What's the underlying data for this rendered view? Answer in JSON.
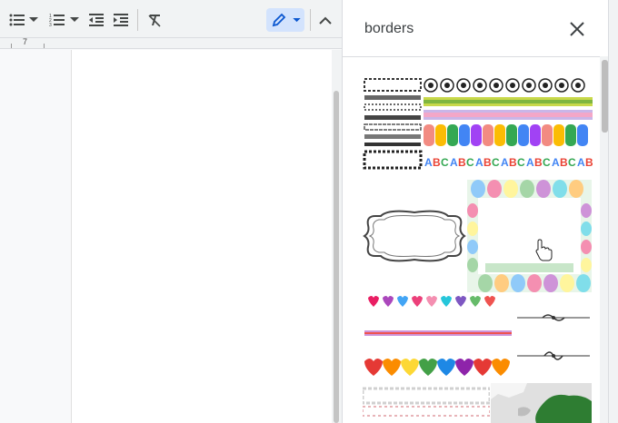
{
  "toolbar": {
    "items": [
      {
        "name": "bulleted-list-icon"
      },
      {
        "name": "bulleted-list-dropdown-icon"
      },
      {
        "name": "numbered-list-icon"
      },
      {
        "name": "numbered-list-dropdown-icon"
      },
      {
        "name": "decrease-indent-icon"
      },
      {
        "name": "increase-indent-icon"
      },
      {
        "name": "clear-formatting-icon"
      },
      {
        "name": "editing-mode-pencil-icon"
      },
      {
        "name": "collapse-menu-chevron-up-icon"
      }
    ],
    "accent": "#d3e3fd",
    "icon_color": "#444746"
  },
  "ruler": {
    "marker": "7"
  },
  "search_panel": {
    "query": "borders",
    "close_icon": "close-icon",
    "results": [
      {
        "name": "result-ornate-borders-collection"
      },
      {
        "name": "result-soccer-ball-clip-borders"
      },
      {
        "name": "result-decorative-frame-outline"
      },
      {
        "name": "result-easter-egg-frame"
      },
      {
        "name": "result-heart-borders"
      },
      {
        "name": "result-flourish-dividers"
      },
      {
        "name": "result-lace-border"
      },
      {
        "name": "result-map-image"
      }
    ]
  },
  "cursor": "hand-pointer-icon"
}
